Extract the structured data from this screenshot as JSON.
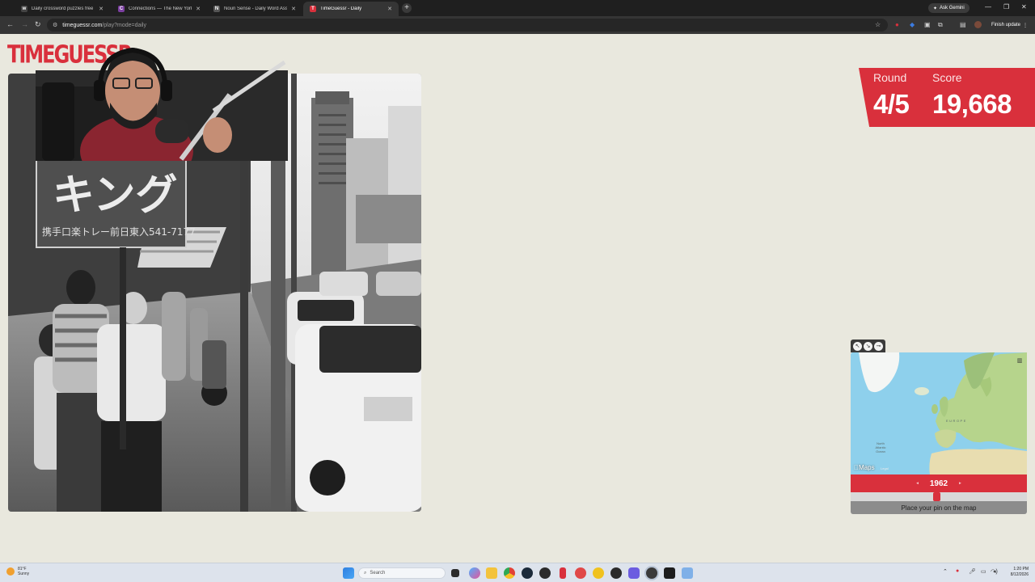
{
  "browser": {
    "tabs": [
      {
        "label": "Daily crossword puzzles free fr",
        "favicon": "w",
        "color": "#444444",
        "active": false
      },
      {
        "label": "Connections — The New York",
        "favicon": "C",
        "color": "#7b3fa0",
        "active": false
      },
      {
        "label": "Noun Sense - Daily Word Asso",
        "favicon": "N",
        "color": "#555555",
        "active": false
      },
      {
        "label": "TimeGuessr - Daily",
        "favicon": "T",
        "color": "#d9303c",
        "active": true
      }
    ],
    "new_tab": "+",
    "gemini_label": "Ask Gemini",
    "finish_update": "Finish update",
    "url_host": "timeguessr.com",
    "url_path": "/play?mode=daily",
    "window_controls": [
      "—",
      "❐",
      "✕"
    ]
  },
  "page": {
    "logo": "TIMEGUESSR",
    "photo_sign_text": "キング",
    "photo_sign_subtext": "携手口楽トレー前日東入541-7177"
  },
  "score": {
    "round_label": "Round",
    "score_label": "Score",
    "round_value": "4/5",
    "score_value": "19,668"
  },
  "map": {
    "brand": "Maps",
    "legal": "Legal",
    "europe_label": "EUROPE",
    "ocean_label": "North Atlantic Ocean",
    "year": "1962",
    "year_prev": "◂",
    "year_next": "▸",
    "year_slider_fraction": 0.49,
    "place_pin": "Place your pin on the map"
  },
  "taskbar": {
    "weather_temp": "81°F",
    "weather_desc": "Sunny",
    "search_placeholder": "Search",
    "time": "1:20 PM",
    "date": "8/12/2026"
  },
  "colors": {
    "accent": "#d9303c",
    "page_bg": "#e9e8de"
  }
}
